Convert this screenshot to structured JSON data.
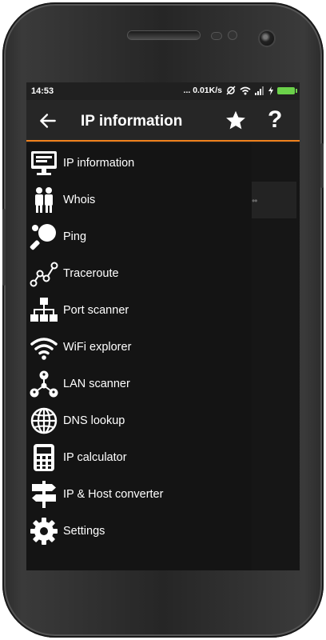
{
  "status_bar": {
    "time": "14:53",
    "net_speed": "... 0.01K/s"
  },
  "app_bar": {
    "title": "IP information",
    "help_label": "?",
    "accent_color": "#f0821e"
  },
  "drawer": {
    "items": [
      {
        "label": "IP information",
        "icon": "monitor-icon"
      },
      {
        "label": "Whois",
        "icon": "people-icon"
      },
      {
        "label": "Ping",
        "icon": "ping-pong-icon"
      },
      {
        "label": "Traceroute",
        "icon": "route-icon"
      },
      {
        "label": "Port scanner",
        "icon": "network-tree-icon"
      },
      {
        "label": "WiFi explorer",
        "icon": "wifi-icon"
      },
      {
        "label": "LAN scanner",
        "icon": "lan-icon"
      },
      {
        "label": "DNS lookup",
        "icon": "globe-icon"
      },
      {
        "label": "IP calculator",
        "icon": "calculator-icon"
      },
      {
        "label": "IP & Host converter",
        "icon": "signpost-icon"
      },
      {
        "label": "Settings",
        "icon": "gear-icon"
      }
    ]
  },
  "content": {
    "dots": "••"
  }
}
